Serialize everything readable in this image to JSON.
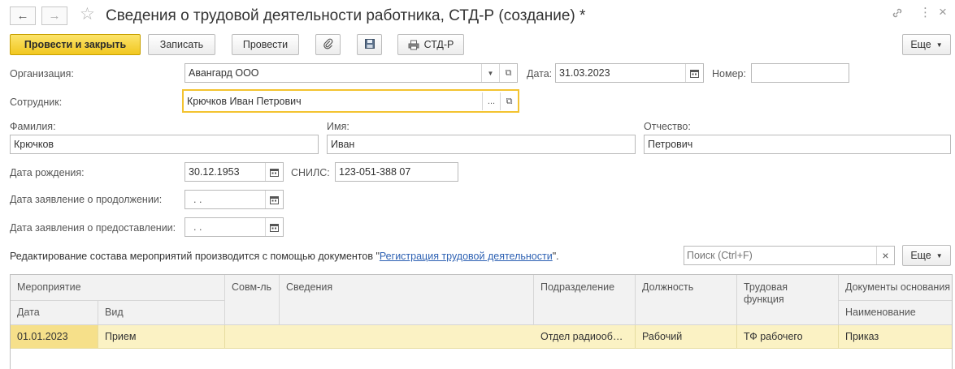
{
  "window": {
    "title": "Сведения о трудовой деятельности работника, СТД-Р (создание) *"
  },
  "toolbar": {
    "post_and_close": "Провести и закрыть",
    "write": "Записать",
    "post": "Провести",
    "std_r": "СТД-Р",
    "more": "Еще"
  },
  "form": {
    "organization_label": "Организация:",
    "organization_value": "Авангард ООО",
    "date_label": "Дата:",
    "date_value": "31.03.2023",
    "number_label": "Номер:",
    "number_value": "",
    "employee_label": "Сотрудник:",
    "employee_value": "Крючков Иван Петрович",
    "last_name_label": "Фамилия:",
    "last_name_value": "Крючков",
    "first_name_label": "Имя:",
    "first_name_value": "Иван",
    "patronymic_label": "Отчество:",
    "patronymic_value": "Петрович",
    "birth_date_label": "Дата рождения:",
    "birth_date_value": "30.12.1953",
    "snils_label": "СНИЛС:",
    "snils_value": "123-051-388 07",
    "continue_date_label": "Дата заявление о продолжении:",
    "continue_date_value": " .  .",
    "provide_date_label": "Дата заявления о предоставлении:",
    "provide_date_value": " .  ."
  },
  "info": {
    "text_before": "Редактирование состава мероприятий производится с помощью документов \"",
    "link": "Регистрация трудовой деятельности",
    "text_after": "\"."
  },
  "search": {
    "placeholder": "Поиск (Ctrl+F)",
    "more": "Еще"
  },
  "table": {
    "headers": {
      "event": "Мероприятие",
      "date": "Дата",
      "kind": "Вид",
      "part_time": "Совм-ль",
      "details": "Сведения",
      "department": "Подразделение",
      "position": "Должность",
      "labor_function": "Трудовая функция",
      "documents": "Документы основания",
      "name": "Наименование"
    },
    "rows": [
      {
        "date": "01.01.2023",
        "kind": "Прием",
        "part_time": "",
        "details": "",
        "department": "Отдел радиооб…",
        "position": "Рабочий",
        "labor_function": "ТФ рабочего",
        "name": "Приказ"
      }
    ]
  },
  "colors": {
    "primary_button": "#f4cd2a",
    "focus_border": "#f3c330",
    "selected_row": "#fbf2c4",
    "link": "#2d61b3"
  }
}
